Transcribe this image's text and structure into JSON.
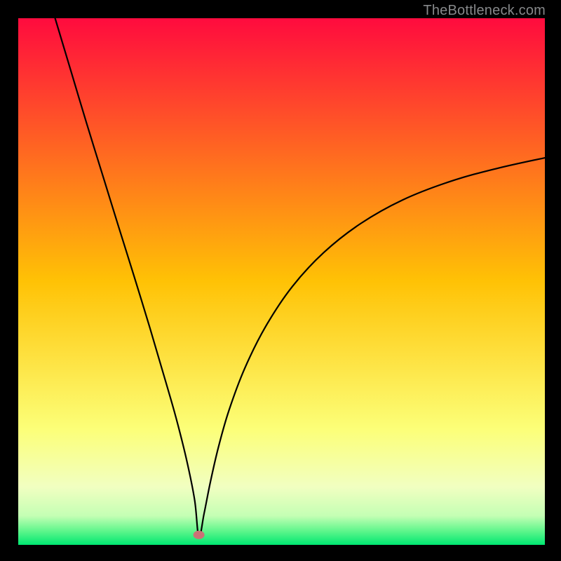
{
  "watermark": "TheBottleneck.com",
  "chart_data": {
    "type": "line",
    "title": "",
    "xlabel": "",
    "ylabel": "",
    "xlim": [
      0,
      100
    ],
    "ylim": [
      0,
      100
    ],
    "grid": false,
    "legend": false,
    "annotations": [],
    "background_gradient": {
      "stops": [
        {
          "offset": 0.0,
          "color": "#ff0b3e"
        },
        {
          "offset": 0.5,
          "color": "#ffc205"
        },
        {
          "offset": 0.78,
          "color": "#fcff78"
        },
        {
          "offset": 0.89,
          "color": "#f1ffc1"
        },
        {
          "offset": 0.945,
          "color": "#c4ffb4"
        },
        {
          "offset": 0.975,
          "color": "#5af58a"
        },
        {
          "offset": 1.0,
          "color": "#00e771"
        }
      ]
    },
    "marker": {
      "x": 34.3,
      "y": 1.9,
      "color": "#cb7176"
    },
    "series": [
      {
        "name": "curve",
        "x": [
          7.0,
          10.0,
          13.0,
          16.0,
          19.0,
          22.0,
          25.0,
          28.0,
          30.0,
          32.0,
          33.5,
          34.3,
          35.3,
          36.5,
          38.0,
          40.0,
          43.0,
          47.0,
          52.0,
          58.0,
          65.0,
          73.0,
          82.0,
          91.0,
          100.0
        ],
        "values": [
          100.0,
          90.0,
          80.0,
          70.3,
          60.6,
          51.0,
          41.2,
          31.0,
          24.0,
          16.0,
          8.5,
          1.5,
          6.0,
          12.0,
          18.5,
          25.5,
          33.5,
          41.5,
          49.0,
          55.5,
          61.0,
          65.5,
          69.0,
          71.5,
          73.5
        ]
      }
    ]
  }
}
